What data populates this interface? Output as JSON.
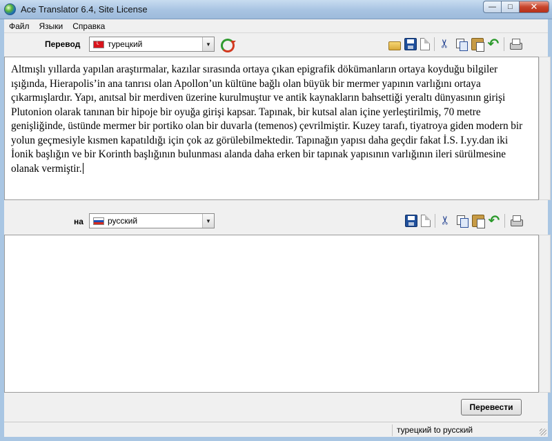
{
  "window": {
    "title": "Ace Translator 6.4, Site License",
    "minimize_label": "—",
    "maximize_label": "□",
    "close_label": "✕"
  },
  "menu": {
    "items": [
      {
        "label": "Файл"
      },
      {
        "label": "Языки"
      },
      {
        "label": "Справка"
      }
    ]
  },
  "source": {
    "label": "Перевод",
    "language": "турецкий",
    "text": "Altmışlı yıllarda yapılan araştırmalar, kazılar sırasında ortaya çıkan epigrafik dökümanların ortaya koyduğu bilgiler ışığında, Hierapolis’in ana tanrısı olan Apollon’un kültüne bağlı olan büyük bir mermer yapının varlığını ortaya çıkarmışlardır.  Yapı, anıtsal bir merdiven üzerine kurulmuştur ve antik kaynakların bahsettiği yeraltı dünyasının girişi Plutonion olarak tanınan  bir hipoje bir oyuğa girişi kapsar. Tapınak, bir kutsal alan içine yerleştirilmiş, 70 metre genişliğinde, üstünde mermer bir portiko olan bir duvarla (temenos) çevrilmiştir. Kuzey tarafı, tiyatroya giden modern bir yolun geçmesiyle kısmen kapatıldığı için çok az görülebilmektedir. Tapınağın yapısı daha geçdir fakat İ.S. I.yy.dan iki İonik başlığın ve bir Korinth başlığının bulunması alanda daha erken bir tapınak yapısının varlığının ileri sürülmesine olanak vermiştir."
  },
  "target": {
    "label": "на",
    "language": "русский",
    "text": ""
  },
  "icons": {
    "source_toolbar": [
      "open-icon",
      "save-icon",
      "new-document-icon",
      "cut-icon",
      "copy-icon",
      "paste-icon",
      "undo-icon",
      "print-icon"
    ],
    "target_toolbar": [
      "save-icon",
      "new-document-icon",
      "cut-icon",
      "copy-icon",
      "paste-icon",
      "undo-icon",
      "print-icon"
    ],
    "swap": "swap-languages-icon"
  },
  "actions": {
    "translate_label": "Перевести"
  },
  "status": {
    "pair": "турецкий to русский"
  }
}
